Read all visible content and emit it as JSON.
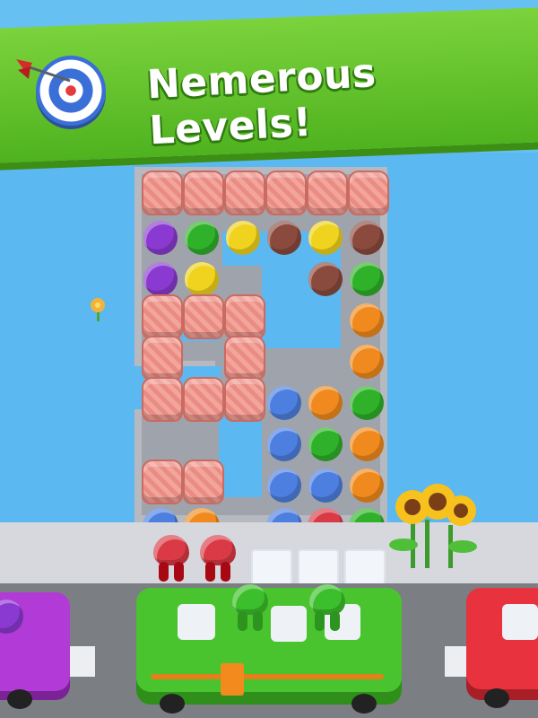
{
  "banner": {
    "title": "Nemerous Levels!",
    "icon": "dart-target-icon",
    "colors": {
      "background": "#5bb32a",
      "text": "#ffffff"
    }
  },
  "colors": {
    "blue": "#4d7fe0",
    "orange": "#f08a1e",
    "green": "#2fb12a",
    "red": "#d93a45",
    "purple": "#8a3ad0",
    "yellow": "#f0d31e",
    "brown": "#8a4a3e",
    "crate": "#ee9990"
  },
  "grid": {
    "cells": [
      {
        "row": 0,
        "col": 0,
        "kind": "crate"
      },
      {
        "row": 0,
        "col": 1,
        "kind": "crate"
      },
      {
        "row": 0,
        "col": 2,
        "kind": "crate"
      },
      {
        "row": 0,
        "col": 3,
        "kind": "crate"
      },
      {
        "row": 0,
        "col": 4,
        "kind": "crate"
      },
      {
        "row": 0,
        "col": 5,
        "kind": "crate"
      },
      {
        "row": 1,
        "col": 0,
        "kind": "purple"
      },
      {
        "row": 1,
        "col": 1,
        "kind": "green"
      },
      {
        "row": 1,
        "col": 2,
        "kind": "yellow"
      },
      {
        "row": 1,
        "col": 3,
        "kind": "brown"
      },
      {
        "row": 1,
        "col": 4,
        "kind": "yellow"
      },
      {
        "row": 1,
        "col": 5,
        "kind": "brown"
      },
      {
        "row": 2,
        "col": 0,
        "kind": "purple"
      },
      {
        "row": 2,
        "col": 1,
        "kind": "yellow"
      },
      {
        "row": 2,
        "col": 4,
        "kind": "brown"
      },
      {
        "row": 2,
        "col": 5,
        "kind": "green"
      },
      {
        "row": 3,
        "col": 0,
        "kind": "crate"
      },
      {
        "row": 3,
        "col": 1,
        "kind": "crate"
      },
      {
        "row": 3,
        "col": 2,
        "kind": "crate"
      },
      {
        "row": 3,
        "col": 5,
        "kind": "orange"
      },
      {
        "row": 4,
        "col": 0,
        "kind": "crate"
      },
      {
        "row": 4,
        "col": 2,
        "kind": "crate"
      },
      {
        "row": 4,
        "col": 5,
        "kind": "orange"
      },
      {
        "row": 5,
        "col": 0,
        "kind": "crate"
      },
      {
        "row": 5,
        "col": 1,
        "kind": "crate"
      },
      {
        "row": 5,
        "col": 2,
        "kind": "crate"
      },
      {
        "row": 5,
        "col": 3,
        "kind": "blue"
      },
      {
        "row": 5,
        "col": 4,
        "kind": "orange"
      },
      {
        "row": 5,
        "col": 5,
        "kind": "green"
      },
      {
        "row": 6,
        "col": 3,
        "kind": "blue"
      },
      {
        "row": 6,
        "col": 4,
        "kind": "green"
      },
      {
        "row": 6,
        "col": 5,
        "kind": "orange"
      },
      {
        "row": 7,
        "col": 0,
        "kind": "crate"
      },
      {
        "row": 7,
        "col": 1,
        "kind": "crate"
      },
      {
        "row": 7,
        "col": 3,
        "kind": "blue"
      },
      {
        "row": 7,
        "col": 4,
        "kind": "blue"
      },
      {
        "row": 7,
        "col": 5,
        "kind": "orange"
      }
    ],
    "front_row": [
      "blue",
      "orange",
      null,
      "blue",
      "red",
      "green"
    ]
  },
  "queue": {
    "waiting": [
      "red",
      "red"
    ],
    "empty_slots": 3
  },
  "buses": [
    {
      "name": "left-bus",
      "color": "purple"
    },
    {
      "name": "center-bus",
      "color": "green",
      "riders": [
        "green",
        "green"
      ]
    },
    {
      "name": "right-bus",
      "color": "red"
    }
  ]
}
